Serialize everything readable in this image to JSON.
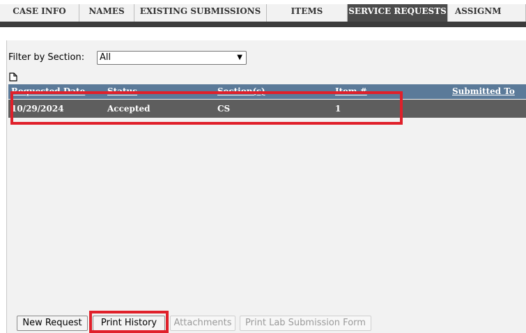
{
  "tabs": [
    {
      "label": "CASE INFO"
    },
    {
      "label": "NAMES"
    },
    {
      "label": "EXISTING SUBMISSIONS"
    },
    {
      "label": "ITEMS"
    },
    {
      "label": "SERVICE REQUESTS",
      "active": true
    },
    {
      "label": "ASSIGNM"
    }
  ],
  "filter": {
    "label": "Filter by Section:",
    "value": "All"
  },
  "grid": {
    "columns": [
      "Requested Date",
      "Status",
      "Section(s)",
      "Item #",
      "Submitted To"
    ],
    "rows": [
      [
        "10/29/2024",
        "Accepted",
        "CS",
        "1",
        ""
      ]
    ]
  },
  "buttons": {
    "new_request": "New Request",
    "print_history": "Print History",
    "attachments": "Attachments",
    "print_lab_form": "Print Lab Submission Form"
  },
  "colors": {
    "active_tab": "#4b4b4b",
    "grid_header": "#5b7a99",
    "selected_row": "#5e5e5e",
    "highlight": "#e0202a"
  }
}
